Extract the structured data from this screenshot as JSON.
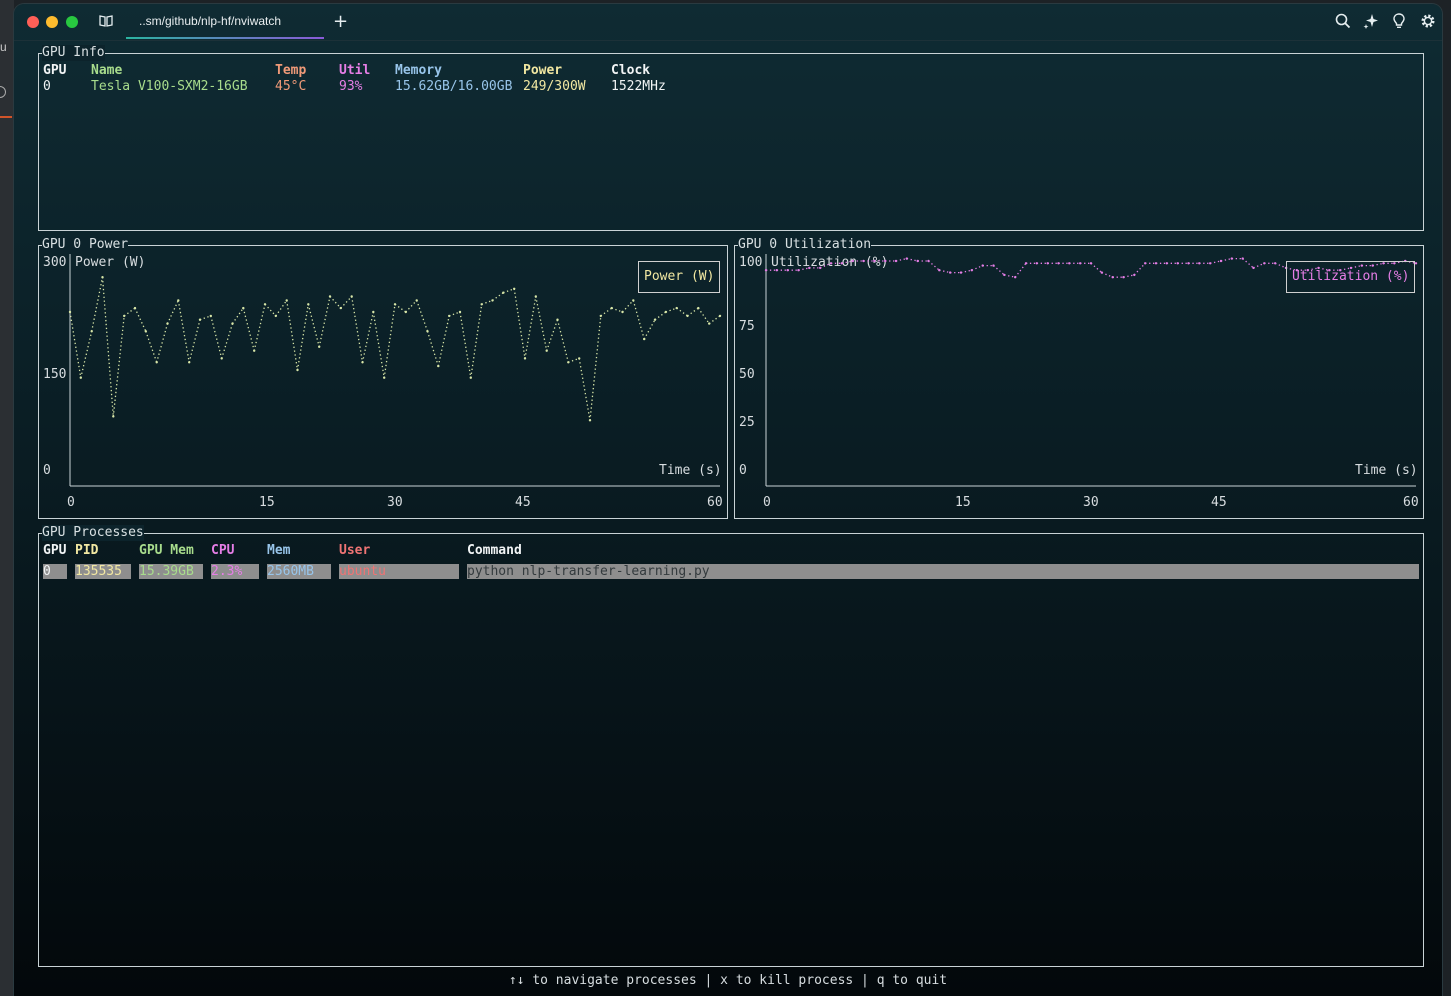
{
  "tab": {
    "title": "..sm/github/nlp-hf/nviwatch"
  },
  "toolbar": {
    "add_tab_label": "+"
  },
  "gpu_info": {
    "title": "GPU Info",
    "headers": [
      "GPU",
      "Name",
      "Temp",
      "Util",
      "Memory",
      "Power",
      "Clock"
    ],
    "row": [
      "0",
      "Tesla V100-SXM2-16GB",
      "45°C",
      "93%",
      "15.62GB/16.00GB",
      "249/300W",
      "1522MHz"
    ]
  },
  "power_chart": {
    "title": "GPU 0 Power",
    "y_name": "Power (W)",
    "y_ticks": [
      "300",
      "150",
      "0"
    ],
    "x_ticks": [
      "0",
      "15",
      "30",
      "45",
      "60"
    ],
    "x_label": "Time (s)",
    "legend": "Power (W)",
    "color": "#d8e6a8"
  },
  "util_chart": {
    "title": "GPU 0 Utilization",
    "y_name": "Utilization (%)",
    "y_ticks": [
      "100",
      "75",
      "50",
      "25",
      "0"
    ],
    "x_ticks": [
      "0",
      "15",
      "30",
      "45",
      "60"
    ],
    "x_label": "Time (s)",
    "legend": "Utilization (%)",
    "color": "#e57ee6"
  },
  "chart_data": [
    {
      "type": "line",
      "title": "GPU 0 Power",
      "ylabel": "Power (W)",
      "xlabel": "Time (s)",
      "xlim": [
        0,
        60
      ],
      "ylim": [
        0,
        300
      ],
      "series": [
        {
          "name": "Power (W)",
          "x": [
            0,
            1,
            2,
            3,
            4,
            5,
            6,
            7,
            8,
            9,
            10,
            11,
            12,
            13,
            14,
            15,
            16,
            17,
            18,
            19,
            20,
            21,
            22,
            23,
            24,
            25,
            26,
            27,
            28,
            29,
            30,
            31,
            32,
            33,
            34,
            35,
            36,
            37,
            38,
            39,
            40,
            41,
            42,
            43,
            44,
            45,
            46,
            47,
            48,
            49,
            50,
            51,
            52,
            53,
            54,
            55,
            56,
            57,
            58,
            59,
            60
          ],
          "values": [
            225,
            140,
            200,
            270,
            90,
            220,
            230,
            200,
            160,
            210,
            240,
            160,
            215,
            220,
            165,
            210,
            230,
            175,
            235,
            220,
            240,
            150,
            235,
            180,
            245,
            230,
            245,
            160,
            225,
            140,
            235,
            225,
            240,
            200,
            155,
            220,
            225,
            140,
            235,
            240,
            250,
            255,
            165,
            245,
            175,
            215,
            160,
            165,
            85,
            220,
            230,
            225,
            240,
            190,
            215,
            225,
            230,
            220,
            230,
            210,
            220
          ]
        }
      ]
    },
    {
      "type": "line",
      "title": "GPU 0 Utilization",
      "ylabel": "Utilization (%)",
      "xlabel": "Time (s)",
      "xlim": [
        0,
        60
      ],
      "ylim": [
        0,
        100
      ],
      "series": [
        {
          "name": "Utilization (%)",
          "x": [
            0,
            1,
            2,
            3,
            4,
            5,
            6,
            7,
            8,
            9,
            10,
            11,
            12,
            13,
            14,
            15,
            16,
            17,
            18,
            19,
            20,
            21,
            22,
            23,
            24,
            25,
            26,
            27,
            28,
            29,
            30,
            31,
            32,
            33,
            34,
            35,
            36,
            37,
            38,
            39,
            40,
            41,
            42,
            43,
            44,
            45,
            46,
            47,
            48,
            49,
            50,
            51,
            52,
            53,
            54,
            55,
            56,
            57,
            58,
            59,
            60
          ],
          "values": [
            93,
            93,
            93,
            93,
            94,
            94,
            96,
            96,
            97,
            97,
            97,
            97,
            97,
            98,
            97,
            97,
            93,
            92,
            92,
            93,
            95,
            95,
            91,
            90,
            96,
            96,
            96,
            96,
            96,
            96,
            96,
            92,
            90,
            90,
            91,
            96,
            96,
            96,
            96,
            96,
            96,
            96,
            97,
            98,
            98,
            94,
            96,
            96,
            94,
            93,
            93,
            94,
            93,
            93,
            94,
            95,
            95,
            96,
            96,
            97,
            96
          ]
        }
      ]
    }
  ],
  "processes": {
    "title": "GPU Processes",
    "headers": [
      "GPU",
      "PID",
      "GPU Mem",
      "CPU",
      "Mem",
      "User",
      "Command"
    ],
    "row": [
      "0",
      "135535",
      "15.39GB",
      "2.3%",
      "2560MB",
      "ubuntu",
      "python nlp-transfer-learning.py"
    ]
  },
  "footer": "↑↓ to navigate processes | x to kill process | q to quit"
}
